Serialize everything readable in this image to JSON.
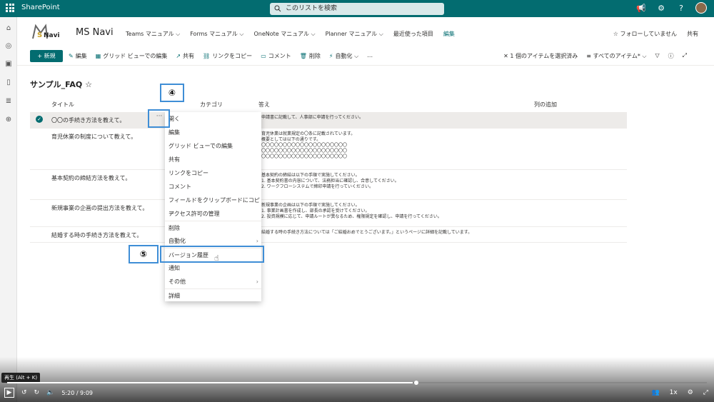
{
  "suite": {
    "title": "SharePoint",
    "search_placeholder": "このリストを検索"
  },
  "site": {
    "logo_text": "MSNavi",
    "name": "MS Navi",
    "nav": [
      "Teams マニュアル ⌵",
      "Forms マニュアル ⌵",
      "OneNote マニュアル ⌵",
      "Planner マニュアル ⌵",
      "最近使った項目",
      "編集"
    ],
    "follow": "☆ フォローしていません",
    "share": "共有"
  },
  "command": {
    "new": "+ 新規",
    "items": [
      "編集",
      "グリッド ビューでの編集",
      "共有",
      "リンクをコピー",
      "コメント",
      "削除",
      "自動化 ⌵",
      "…"
    ],
    "selected": "1 個のアイテムを選択済み",
    "view": "すべてのアイテム* ⌵"
  },
  "list": {
    "title": "サンプル_FAQ",
    "columns": [
      "タイトル",
      "カテゴリ",
      "答え",
      "列の追加"
    ],
    "rows": [
      {
        "title": "〇〇の手続き方法を教えて。",
        "answer": "申請書に記載して、人事部に申請を行ってください。"
      },
      {
        "title": "育児休業の制度について教えて。",
        "answer": "育児休業は就業規定の〇条に記載されています。\n概要としては以下の通りです。\n〇〇〇〇〇〇〇〇〇〇〇〇〇〇〇〇〇〇〇〇\n〇〇〇〇〇〇〇〇〇〇〇〇〇〇〇〇〇〇〇〇\n〇〇〇〇〇〇〇〇〇〇〇〇〇〇〇〇〇〇〇〇"
      },
      {
        "title": "基本契約の締結方法を教えて。",
        "answer": "基本契約の締結は以下の手順で実施してください。\n1. 基本契約書の内容について、法務担当に確認し、合意してください。\n2. ワークフローシステムで締印申請を行っていください。"
      },
      {
        "title": "新規事業の企画の提出方法を教えて。",
        "answer": "新規事業の企画は以下の手順で実施してください。\n1. 事業計画書を作成し、部長の承認を受けてください。\n2. 投資規模に応じて、申請ルートが異なるため、権限規定を確認し、申請を行ってください。"
      },
      {
        "title": "結婚する時の手続き方法を教えて。",
        "answer": "結婚する時の手続き方法については「ご結婚おめでとうございます。」というページに詳細を記載しています。"
      }
    ]
  },
  "context_menu": [
    "開く",
    "編集",
    "グリッド ビューでの編集",
    "共有",
    "リンクをコピー",
    "コメント",
    "フィールドをクリップボードにコピー",
    "アクセス許可の管理",
    "削除",
    "自動化",
    "バージョン履歴",
    "通知",
    "その他",
    "詳細"
  ],
  "callouts": {
    "four": "④",
    "five": "⑤"
  },
  "player": {
    "tooltip": "再生 (Alt + K)",
    "time": "5:20 / 9:09",
    "speed": "1x",
    "progress": 0.58
  }
}
